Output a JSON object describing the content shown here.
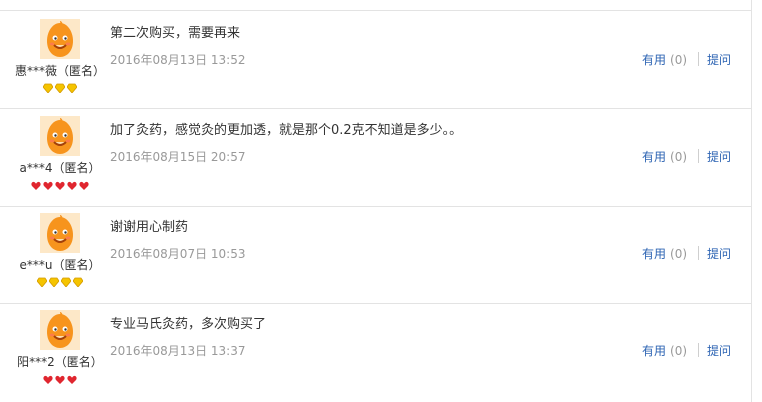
{
  "reviews": [
    {
      "user": "惠***薇（匿名）",
      "content": "第二次购买，需要再来",
      "date": "2016年08月13日 13:52",
      "helpful_label": "有用",
      "helpful_count": "(0)",
      "ask_label": "提问",
      "badges": [
        "gold-diamond",
        "gold-diamond",
        "gold-diamond"
      ]
    },
    {
      "user": "a***4（匿名）",
      "content": "加了灸药，感觉灸的更加透，就是那个0.2克不知道是多少。。",
      "date": "2016年08月15日 20:57",
      "helpful_label": "有用",
      "helpful_count": "(0)",
      "ask_label": "提问",
      "badges": [
        "red-heart",
        "red-heart",
        "red-heart",
        "red-heart",
        "red-heart"
      ]
    },
    {
      "user": "e***u（匿名）",
      "content": "谢谢用心制药",
      "date": "2016年08月07日 10:53",
      "helpful_label": "有用",
      "helpful_count": "(0)",
      "ask_label": "提问",
      "badges": [
        "gold-diamond",
        "gold-diamond",
        "gold-diamond",
        "gold-diamond"
      ]
    },
    {
      "user": "阳***2（匿名）",
      "content": "专业马氏灸药，多次购买了",
      "date": "2016年08月13日 13:37",
      "helpful_label": "有用",
      "helpful_count": "(0)",
      "ask_label": "提问",
      "badges": [
        "red-heart",
        "red-heart",
        "red-heart"
      ]
    }
  ],
  "colors": {
    "link": "#2d64b3",
    "muted": "#999999",
    "avatar_orange": "#f7941d",
    "badge_gold": "#f5c400",
    "badge_red": "#e0262f"
  },
  "icons": {
    "avatar": "orange-mascot-avatar-icon"
  }
}
